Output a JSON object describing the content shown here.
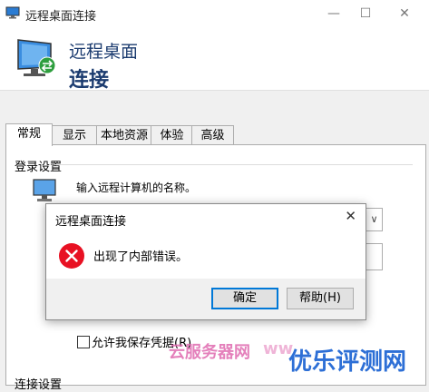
{
  "window": {
    "title": "远程桌面连接",
    "minimize": "—",
    "maximize": "☐",
    "close": "✕"
  },
  "banner": {
    "line1": "远程桌面",
    "line2": "连接"
  },
  "tabs": [
    "常规",
    "显示",
    "本地资源",
    "体验",
    "高级"
  ],
  "general": {
    "logon_group_label": "登录设置",
    "instruction": "输入远程计算机的名称。",
    "save_credentials_label": "允许我保存凭据(R)",
    "connection_group_label": "连接设置"
  },
  "dialog": {
    "title": "远程桌面连接",
    "close": "✕",
    "message": "出现了内部错误。",
    "ok_label": "确定",
    "help_label": "帮助(H)",
    "icon": "error-icon"
  },
  "watermark": {
    "text1": "云服务器网",
    "text2": "ww",
    "text3": "优乐评测网"
  },
  "colors": {
    "accent": "#0078d7",
    "error": "#e81123",
    "banner_text": "#1b3b6f"
  }
}
